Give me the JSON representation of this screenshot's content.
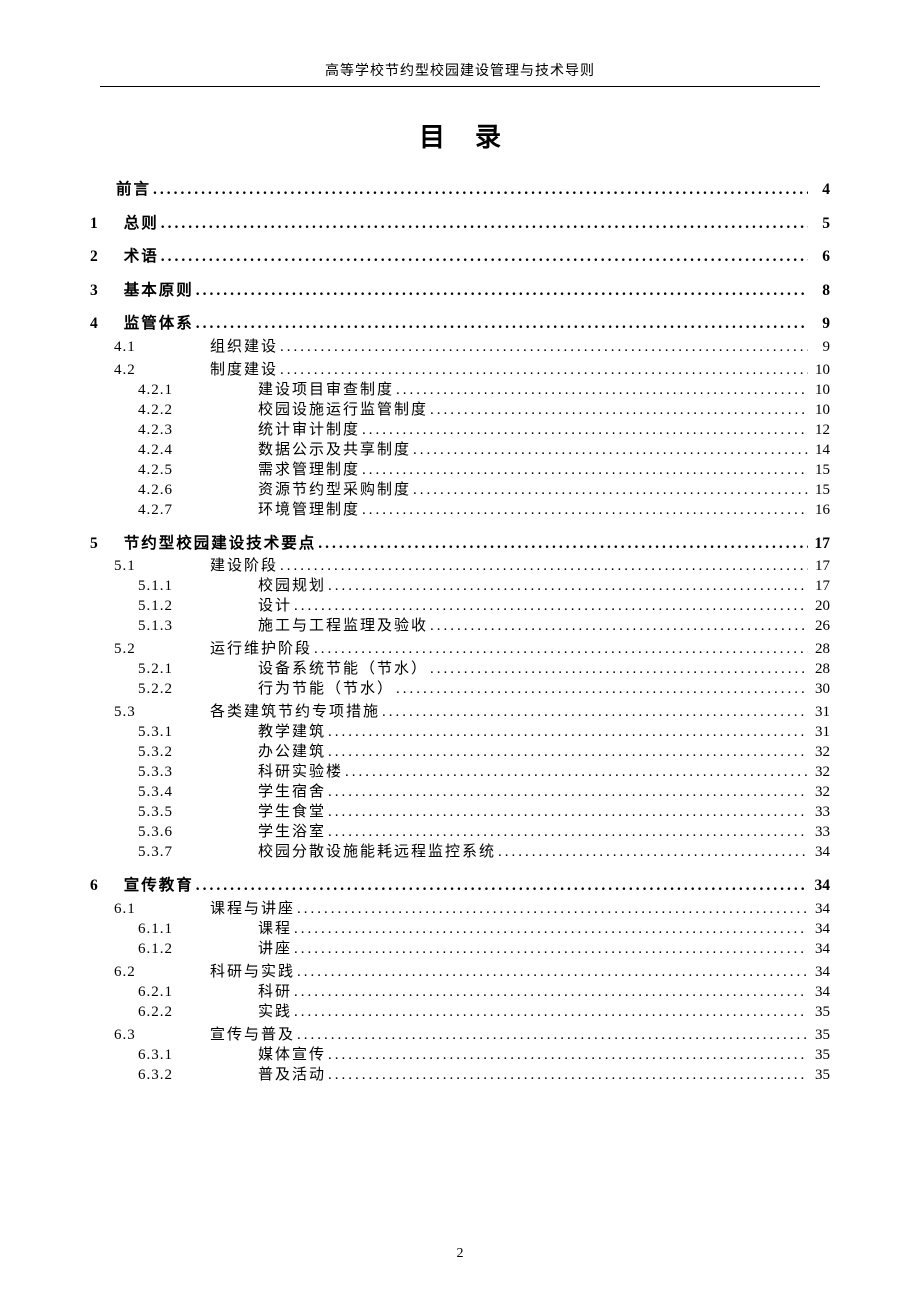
{
  "running_head": "高等学校节约型校园建设管理与技术导则",
  "toc_title": "目录",
  "page_number": "2",
  "entries": [
    {
      "level": 0,
      "num": "",
      "label": "前言",
      "page": "4"
    },
    {
      "level": 0,
      "num": "1",
      "label": "总则",
      "page": "5"
    },
    {
      "level": 0,
      "num": "2",
      "label": "术语",
      "page": "6"
    },
    {
      "level": 0,
      "num": "3",
      "label": "基本原则",
      "page": "8"
    },
    {
      "level": 0,
      "num": "4",
      "label": "监管体系",
      "page": "9"
    },
    {
      "level": 1,
      "num": "4.1",
      "label": "组织建设",
      "page": "9"
    },
    {
      "level": 1,
      "num": "4.2",
      "label": "制度建设",
      "page": "10"
    },
    {
      "level": 2,
      "num": "4.2.1",
      "label": "建设项目审查制度",
      "page": "10"
    },
    {
      "level": 2,
      "num": "4.2.2",
      "label": "校园设施运行监管制度",
      "page": "10"
    },
    {
      "level": 2,
      "num": "4.2.3",
      "label": "统计审计制度",
      "page": "12"
    },
    {
      "level": 2,
      "num": "4.2.4",
      "label": "数据公示及共享制度",
      "page": "14"
    },
    {
      "level": 2,
      "num": "4.2.5",
      "label": "需求管理制度",
      "page": "15"
    },
    {
      "level": 2,
      "num": "4.2.6",
      "label": "资源节约型采购制度",
      "page": "15"
    },
    {
      "level": 2,
      "num": "4.2.7",
      "label": "环境管理制度",
      "page": "16"
    },
    {
      "level": 0,
      "num": "5",
      "label": "节约型校园建设技术要点",
      "page": "17"
    },
    {
      "level": 1,
      "num": "5.1",
      "label": "建设阶段",
      "page": "17"
    },
    {
      "level": 2,
      "num": "5.1.1",
      "label": "校园规划",
      "page": "17"
    },
    {
      "level": 2,
      "num": "5.1.2",
      "label": "设计",
      "page": "20"
    },
    {
      "level": 2,
      "num": "5.1.3",
      "label": "施工与工程监理及验收",
      "page": "26"
    },
    {
      "level": 1,
      "num": "5.2",
      "label": "运行维护阶段",
      "page": "28"
    },
    {
      "level": 2,
      "num": "5.2.1",
      "label": "设备系统节能（节水）",
      "page": "28"
    },
    {
      "level": 2,
      "num": "5.2.2",
      "label": "行为节能（节水）",
      "page": "30"
    },
    {
      "level": 1,
      "num": "5.3",
      "label": "各类建筑节约专项措施",
      "page": "31"
    },
    {
      "level": 2,
      "num": "5.3.1",
      "label": "教学建筑",
      "page": "31"
    },
    {
      "level": 2,
      "num": "5.3.2",
      "label": "办公建筑",
      "page": "32"
    },
    {
      "level": 2,
      "num": "5.3.3",
      "label": "科研实验楼",
      "page": "32"
    },
    {
      "level": 2,
      "num": "5.3.4",
      "label": "学生宿舍",
      "page": "32"
    },
    {
      "level": 2,
      "num": "5.3.5",
      "label": "学生食堂",
      "page": "33"
    },
    {
      "level": 2,
      "num": "5.3.6",
      "label": "学生浴室",
      "page": "33"
    },
    {
      "level": 2,
      "num": "5.3.7",
      "label": "校园分散设施能耗远程监控系统",
      "page": "34"
    },
    {
      "level": 0,
      "num": "6",
      "label": "宣传教育",
      "page": "34"
    },
    {
      "level": 1,
      "num": "6.1",
      "label": "课程与讲座",
      "page": "34"
    },
    {
      "level": 2,
      "num": "6.1.1",
      "label": "课程",
      "page": "34"
    },
    {
      "level": 2,
      "num": "6.1.2",
      "label": "讲座",
      "page": "34"
    },
    {
      "level": 1,
      "num": "6.2",
      "label": "科研与实践",
      "page": "34"
    },
    {
      "level": 2,
      "num": "6.2.1",
      "label": "科研",
      "page": "34"
    },
    {
      "level": 2,
      "num": "6.2.2",
      "label": "实践",
      "page": "35"
    },
    {
      "level": 1,
      "num": "6.3",
      "label": "宣传与普及",
      "page": "35"
    },
    {
      "level": 2,
      "num": "6.3.1",
      "label": "媒体宣传",
      "page": "35"
    },
    {
      "level": 2,
      "num": "6.3.2",
      "label": "普及活动",
      "page": "35"
    }
  ]
}
